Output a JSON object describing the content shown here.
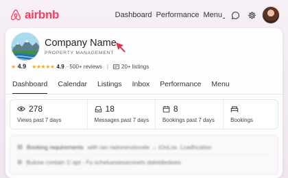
{
  "brand": {
    "name": "airbnb",
    "color": "#ff385c"
  },
  "topnav": {
    "items": [
      "Dashboard",
      "Performance",
      "Menu"
    ],
    "icons": [
      "chat-icon",
      "settings-icon",
      "avatar"
    ]
  },
  "company": {
    "name": "Company Name",
    "subtitle": "PROPERTY MANAGEMENT"
  },
  "rating": {
    "score": "4.9",
    "star_score": "4.9",
    "stars": "★★★★★",
    "reviews": "· 500+ reviews",
    "listings": "20+ listings"
  },
  "tabs": [
    {
      "label": "Dashboard",
      "active": true
    },
    {
      "label": "Calendar",
      "active": false
    },
    {
      "label": "Listings",
      "active": false
    },
    {
      "label": "Inbox",
      "active": false
    },
    {
      "label": "Performance",
      "active": false
    },
    {
      "label": "Menu",
      "active": false
    }
  ],
  "stats": [
    {
      "icon": "eye-icon",
      "value": "278",
      "label": "Views past 7 days"
    },
    {
      "icon": "inbox-icon",
      "value": "18",
      "label": "Messages past 7 days"
    },
    {
      "icon": "calendar-icon",
      "value": "8",
      "label": "Bookings past 7 days"
    },
    {
      "icon": "bed-icon",
      "value": "",
      "label": "Bookings"
    }
  ],
  "blurred_rows": [
    {
      "title": "Booking requirements",
      "text": "with ran radonenstocele → iOnLos. Lcadhcation"
    },
    {
      "title": "",
      "text": "Bulose contain 1! apt - Fu scheluesiesaconets daletdiedwes"
    }
  ]
}
